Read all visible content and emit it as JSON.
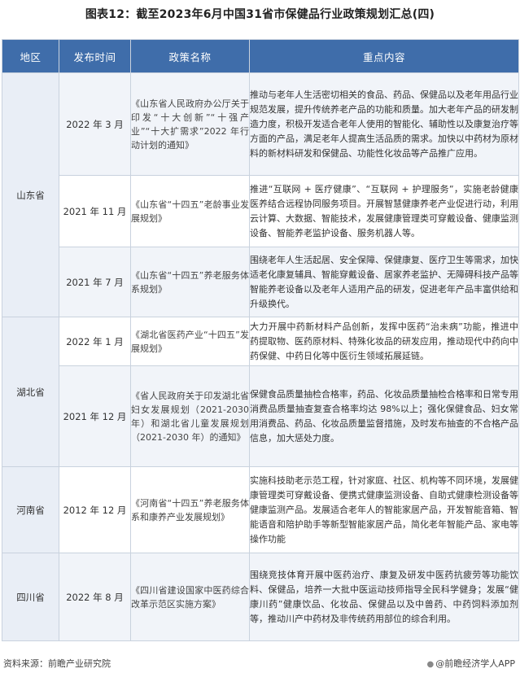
{
  "title": "图表12：截至2023年6月中国31省市保健品行业政策规划汇总(四)",
  "headers": [
    "地区",
    "发布时间",
    "政策名称",
    "重点内容"
  ],
  "groups": [
    {
      "region": "山东省",
      "rows": [
        {
          "date": "2022 年 3 月",
          "policy": "《山东省人民政府办公厅关于印发“十大创新”“十强产业”“十大扩需求”2022 年行动计划的通知》",
          "content": "推动与老年人生活密切相关的食品、药品、保健品以及老年用品行业规范发展，提升传统养老产品的功能和质量。加大老年产品的研发制造力度，积极开发适合老年人使用的智能化、辅助性以及康复治疗等方面的产品，满足老年人提高生活品质的需求。加快以中药材为原材料的新材料研发和保健品、功能性化妆品等产品推广应用。"
        },
        {
          "date": "2021 年 11 月",
          "policy": "《山东省“十四五”老龄事业发展规划》",
          "content": "推进“互联网 + 医疗健康”、“互联网 + 护理服务”，实施老龄健康医养结合远程协同服务项目。开展智慧健康养老产业促进行动，利用云计算、大数据、智能技术，发展健康管理类可穿戴设备、健康监测设备、智能养老监护设备、服务机器人等。"
        },
        {
          "date": "2021 年 7 月",
          "policy": "《山东省“十四五”养老服务体系规划》",
          "content": "围绕老年人生活起居、安全保障、保健康复、医疗卫生等需求，加快适老化康复辅具、智能穿戴设备、居家养老监护、无障碍科技产品等智能养老设备以及老年人适用产品的研发，促进老年产品丰富供给和升级换代。"
        }
      ]
    },
    {
      "region": "湖北省",
      "rows": [
        {
          "date": "2022 年 1 月",
          "policy": "《湖北省医药产业“十四五”发展规划》",
          "content": "大力开展中药新材料产品创新，发挥中医药“治未病”功能，推进中药提取物、医药原材料、特殊化妆品的研发应用，推动现代中药向中药保健、中药日化等中医衍生领域拓展延链。"
        },
        {
          "date": "2021 年 12 月",
          "policy": "《省人民政府关于印发湖北省妇女发展规划（2021-2030 年）和湖北省儿童发展规划（2021-2030 年）的通知》",
          "content": "保健食品质量抽检合格率，药品、化妆品质量抽检合格率和日常专用消费品质量抽查复查合格率均达 98%以上；强化保健食品、妇女常用消费品、药品、化妆品质量监督措施，及时发布抽查的不合格产品信息，加大惩处力度。"
        }
      ]
    },
    {
      "region": "河南省",
      "rows": [
        {
          "date": "2012 年 12 月",
          "policy": "《河南省“十四五”养老服务体系和康养产业发展规划》",
          "content": "实施科技助老示范工程，针对家庭、社区、机构等不同环境，发展健康管理类可穿戴设备、便携式健康监测设备、自助式健康检测设备等健康监测产品。发展适合老年人的智能家居产品，开发智能音箱、智能语音和陪护助手等新型智能家居产品，简化老年智能产品、家电等操作功能"
        }
      ]
    },
    {
      "region": "四川省",
      "rows": [
        {
          "date": "2022 年 8 月",
          "policy": "《四川省建设国家中医药综合改革示范区实施方案》",
          "content": "围绕竞技体育开展中医药治疗、康复及研发中医药抗疲劳等功能饮料、保健品，培养一大批中医运动技师指导全民科学健身；发展“健康川药”健康饮品、化妆品、保健品以及中兽药、中药饲料添加剂等，推动川产中药材及非传统药用部位的综合利用。"
        }
      ]
    }
  ],
  "footer": {
    "source": "资料来源：前瞻产业研究院",
    "brand": "@前瞻经济学人APP"
  }
}
